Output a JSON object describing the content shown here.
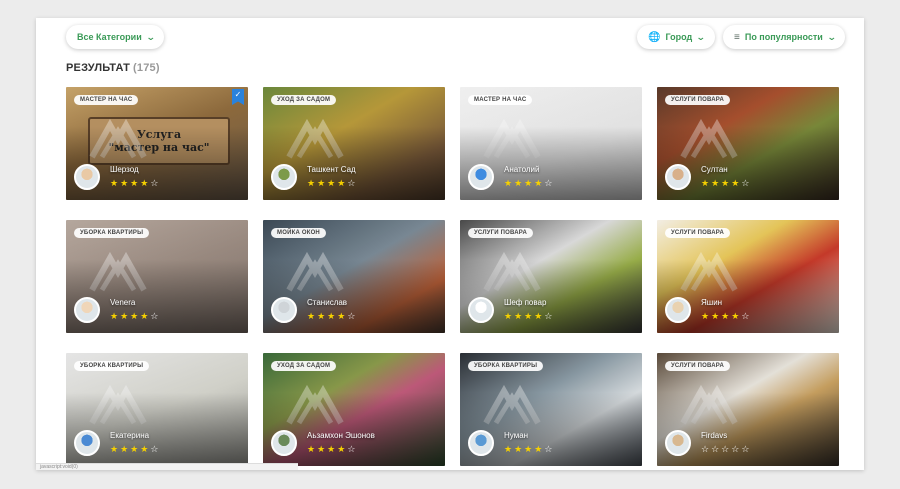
{
  "filters": {
    "categories_label": "Все Категории",
    "city_label": "Город",
    "sort_label": "По популярности"
  },
  "results": {
    "label": "РЕЗУЛЬТАТ",
    "count": "(175)"
  },
  "sign_text": {
    "line1": "Услуга",
    "line2": "\"мастер на час\""
  },
  "cards": [
    {
      "category": "МАСТЕР НА ЧАС",
      "name": "Шерзод",
      "rating": 4,
      "verified": true,
      "bg": "linear-gradient(160deg,#c9a56a 0%,#8f6b3d 45%,#6a5a4a 100%)",
      "avatar": "#e9c9a5"
    },
    {
      "category": "УХОД ЗА САДОМ",
      "name": "Ташкент Сад",
      "rating": 4,
      "bg": "linear-gradient(150deg,#6c8a3c 0%,#b99a3a 40%,#7a5a3a 75%,#4d3a2a 100%)",
      "avatar": "#7c9a4a"
    },
    {
      "category": "МАСТЕР НА ЧАС",
      "name": "Анатолий",
      "rating": 4,
      "bg": "linear-gradient(160deg,#f4f4f4 0%,#e5e5e5 60%,#c9c9c9 100%)",
      "avatar": "#3d8be0"
    },
    {
      "category": "УСЛУГИ ПОВАРА",
      "name": "Султан",
      "rating": 4,
      "bg": "linear-gradient(150deg,#5a3a2a 0%,#a8502e 35%,#7a8a3a 60%,#3a2a22 100%)",
      "avatar": "#d8b08a"
    },
    {
      "category": "УБОРКА КВАРТИРЫ",
      "name": "Venera",
      "rating": 4,
      "bg": "linear-gradient(160deg,#b8aaa0 0%,#9a8a80 50%,#7d7068 100%)",
      "avatar": "#f0d6b8"
    },
    {
      "category": "МОЙКА ОКОН",
      "name": "Станислав",
      "rating": 4,
      "bg": "linear-gradient(150deg,#3c4a56 0%,#7a8a96 45%,#c0633a 75%,#4a3a30 100%)",
      "avatar": "#cfd4d8"
    },
    {
      "category": "УСЛУГИ ПОВАРА",
      "name": "Шеф повар",
      "rating": 4,
      "bg": "linear-gradient(150deg,#4a4a4a 0%,#dcdcdc 40%,#9ab04a 65%,#3a3a3a 100%)",
      "avatar": "#ffffff"
    },
    {
      "category": "УСЛУГИ ПОВАРА",
      "name": "Яшин",
      "rating": 4,
      "bg": "linear-gradient(150deg,#f7f2e8 0%,#e8c85a 35%,#c83a2a 60%,#efe7dc 100%)",
      "avatar": "#e9d2b0"
    },
    {
      "category": "УБОРКА КВАРТИРЫ",
      "name": "Екатерина",
      "rating": 4,
      "bg": "linear-gradient(160deg,#e9e9e9 0%,#d4d4cc 50%,#9a9a94 100%)",
      "avatar": "#4a8ad4"
    },
    {
      "category": "УХОД ЗА САДОМ",
      "name": "Аьзамхон Эшонов",
      "rating": 4,
      "bg": "linear-gradient(150deg,#3a6a3a 0%,#8a9a4a 35%,#c05a7a 55%,#2e4e2e 100%)",
      "avatar": "#6a8a5a"
    },
    {
      "category": "УБОРКА КВАРТИРЫ",
      "name": "Нуман",
      "rating": 4,
      "bg": "linear-gradient(150deg,#2a2e34 0%,#8a9aa4 40%,#d8dde0 65%,#4a5058 100%)",
      "avatar": "#5a9ad4"
    },
    {
      "category": "УСЛУГИ ПОВАРА",
      "name": "Firdavs",
      "rating": 0,
      "bg": "linear-gradient(150deg,#5a4a3a 0%,#e8e4dc 40%,#c8a060 60%,#3a322a 100%)",
      "avatar": "#d8b890"
    }
  ],
  "statusbar_text": "javascript:void(0)"
}
